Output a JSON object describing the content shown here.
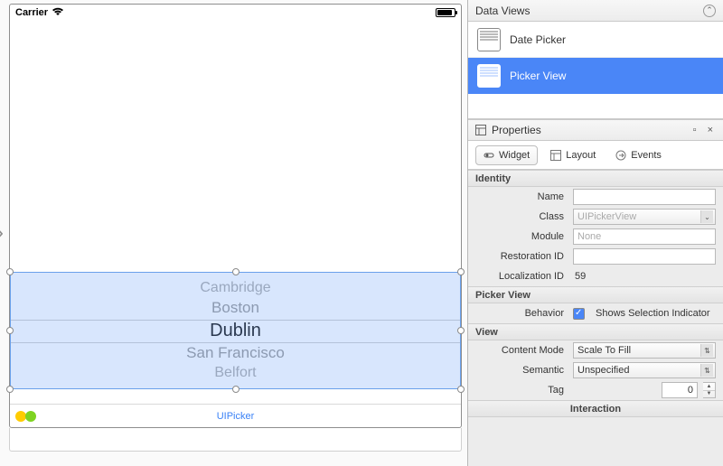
{
  "status_bar": {
    "carrier": "Carrier"
  },
  "picker": {
    "rows": [
      "Cambridge",
      "Boston",
      "Dublin",
      "San Francisco",
      "Belfort"
    ],
    "selected_index": 2
  },
  "footer_label": "UIPicker",
  "data_views": {
    "title": "Data Views",
    "items": [
      {
        "label": "Date Picker",
        "selected": false
      },
      {
        "label": "Picker View",
        "selected": true
      }
    ]
  },
  "properties": {
    "title": "Properties",
    "tabs": {
      "widget": "Widget",
      "layout": "Layout",
      "events": "Events"
    },
    "sections": {
      "identity": {
        "title": "Identity",
        "name": {
          "label": "Name",
          "value": ""
        },
        "class": {
          "label": "Class",
          "value": "UIPickerView"
        },
        "module": {
          "label": "Module",
          "value": "None"
        },
        "restoration_id": {
          "label": "Restoration ID",
          "value": ""
        },
        "localization_id": {
          "label": "Localization ID",
          "value": "59"
        }
      },
      "picker_view": {
        "title": "Picker View",
        "behavior_label": "Behavior",
        "shows_indicator_label": "Shows Selection Indicator",
        "shows_indicator_checked": true
      },
      "view": {
        "title": "View",
        "content_mode": {
          "label": "Content Mode",
          "value": "Scale To Fill"
        },
        "semantic": {
          "label": "Semantic",
          "value": "Unspecified"
        },
        "tag": {
          "label": "Tag",
          "value": "0"
        }
      },
      "interaction": {
        "title": "Interaction"
      }
    }
  }
}
